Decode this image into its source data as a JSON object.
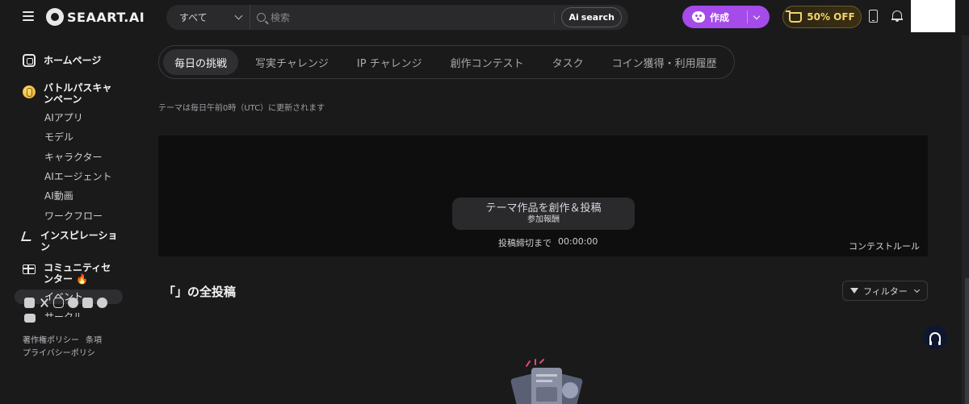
{
  "header": {
    "logo_text": "SEAART.AI",
    "search_scope": "すべて",
    "search_placeholder": "検索",
    "ai_search_label": "search",
    "ai_badge": "Ai",
    "create_label": "作成",
    "promo_label": "50% OFF"
  },
  "sidebar": {
    "home": "ホームページ",
    "battle_pass": "バトルパスキャンペーン",
    "ai_app": "AIアプリ",
    "model": "モデル",
    "character": "キャラクター",
    "ai_agent": "AIエージェント",
    "ai_video": "AI動画",
    "workflow": "ワークフロー",
    "inspiration": "インスピレーション",
    "community_center": "コミュニティセンター",
    "event": "イベント",
    "circle": "サークル",
    "social_icons": [
      "discord-icon",
      "x-icon",
      "instagram-icon",
      "facebook-icon",
      "tiktok-icon",
      "reddit-icon",
      "youtube-icon"
    ],
    "footer": {
      "copyright_policy": "著作権ポリシー",
      "terms": "条項",
      "privacy": "プライバシーポリシ"
    }
  },
  "tabs": [
    "毎日の挑戦",
    "写実チャレンジ",
    "IP チャレンジ",
    "創作コンテスト",
    "タスク",
    "コイン獲得・利用履歴"
  ],
  "main": {
    "update_note": "テーマは毎日午前0時（UTC）に更新されます",
    "banner": {
      "create_button": "テーマ作品を創作＆投稿",
      "reward_text": "参加報酬",
      "deadline_label": "投稿締切まで",
      "deadline_time": "00:00:00",
      "rules_link": "コンテストルール"
    },
    "section_title": "「」の全投稿",
    "filter_label": "フィルター"
  },
  "colors": {
    "accent_purple": "#a44bea",
    "promo_gold": "#f3d36b",
    "background": "#1a1a1b"
  }
}
